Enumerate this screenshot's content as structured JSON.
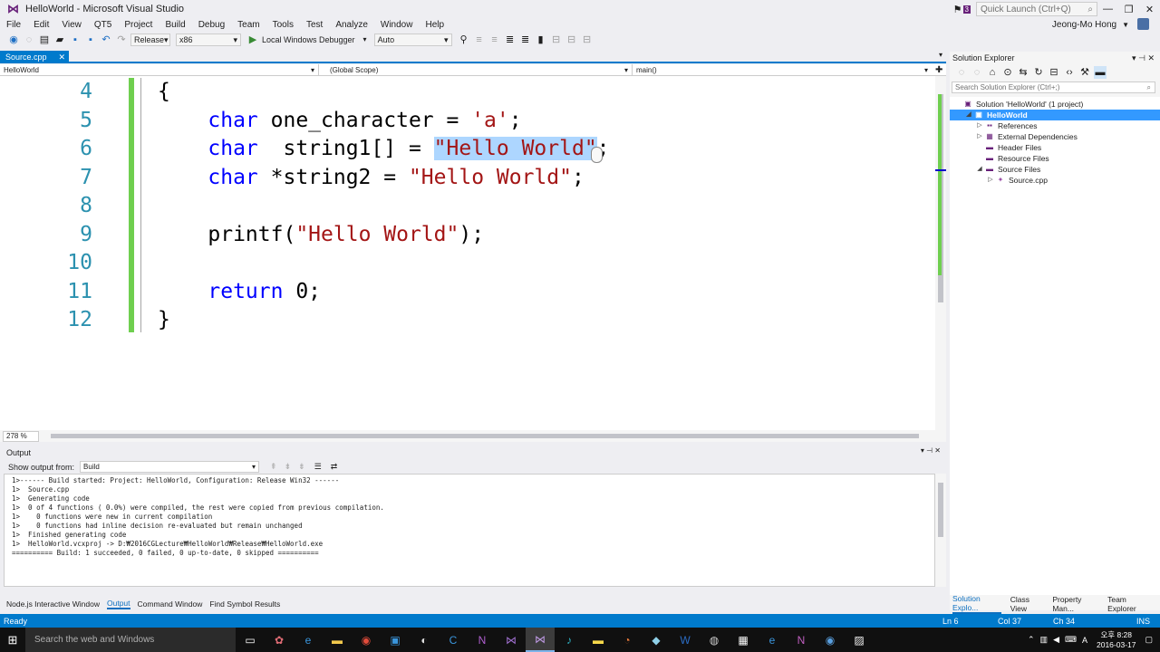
{
  "window": {
    "title": "HelloWorld - Microsoft Visual Studio",
    "logo_glyph": "⋈",
    "notification_count": "3",
    "quick_launch_placeholder": "Quick Launch (Ctrl+Q)",
    "user_name": "Jeong-Mo Hong",
    "controls": [
      "—",
      "❐",
      "✕"
    ]
  },
  "menu": [
    "File",
    "Edit",
    "View",
    "QT5",
    "Project",
    "Build",
    "Debug",
    "Team",
    "Tools",
    "Test",
    "Analyze",
    "Window",
    "Help"
  ],
  "toolbar": {
    "config": "Release",
    "platform": "x86",
    "debugger": "Local Windows Debugger",
    "debugger_mode": "Auto"
  },
  "doc_tab": {
    "label": "Source.cpp"
  },
  "navbar": {
    "project": "HelloWorld",
    "scope": "(Global Scope)",
    "member": "main()"
  },
  "editor": {
    "zoom": "278 %",
    "lines": [
      {
        "num": "4",
        "tokens": [
          {
            "t": "{",
            "c": ""
          }
        ]
      },
      {
        "num": "5",
        "tokens": [
          {
            "t": "    ",
            "c": ""
          },
          {
            "t": "char",
            "c": "kw"
          },
          {
            "t": " one_character = ",
            "c": ""
          },
          {
            "t": "'a'",
            "c": "str"
          },
          {
            "t": ";",
            "c": ""
          }
        ]
      },
      {
        "num": "6",
        "tokens": [
          {
            "t": "    ",
            "c": ""
          },
          {
            "t": "char",
            "c": "kw"
          },
          {
            "t": "  string1[] = ",
            "c": ""
          },
          {
            "t": "\"Hello World\"",
            "c": "str sel"
          },
          {
            "t": ";",
            "c": ""
          }
        ]
      },
      {
        "num": "7",
        "tokens": [
          {
            "t": "    ",
            "c": ""
          },
          {
            "t": "char",
            "c": "kw"
          },
          {
            "t": " *string2 = ",
            "c": ""
          },
          {
            "t": "\"Hello World\"",
            "c": "str"
          },
          {
            "t": ";",
            "c": ""
          }
        ]
      },
      {
        "num": "8",
        "tokens": []
      },
      {
        "num": "9",
        "tokens": [
          {
            "t": "    printf(",
            "c": ""
          },
          {
            "t": "\"Hello World\"",
            "c": "str"
          },
          {
            "t": ");",
            "c": ""
          }
        ]
      },
      {
        "num": "10",
        "tokens": []
      },
      {
        "num": "11",
        "tokens": [
          {
            "t": "    ",
            "c": ""
          },
          {
            "t": "return",
            "c": "kw"
          },
          {
            "t": " 0;",
            "c": ""
          }
        ]
      },
      {
        "num": "12",
        "tokens": [
          {
            "t": "}",
            "c": ""
          }
        ]
      }
    ]
  },
  "output": {
    "title": "Output",
    "show_from_label": "Show output from:",
    "source": "Build",
    "lines": [
      "1>------ Build started: Project: HelloWorld, Configuration: Release Win32 ------",
      "1>  Source.cpp",
      "1>  Generating code",
      "1>  0 of 4 functions ( 0.0%) were compiled, the rest were copied from previous compilation.",
      "1>    0 functions were new in current compilation",
      "1>    0 functions had inline decision re-evaluated but remain unchanged",
      "1>  Finished generating code",
      "1>  HelloWorld.vcxproj -> D:₩2016CGLecture₩HelloWorld₩Release₩HelloWorld.exe",
      "========== Build: 1 succeeded, 0 failed, 0 up-to-date, 0 skipped =========="
    ]
  },
  "bottom_tabs": [
    {
      "label": "Node.js Interactive Window",
      "active": false
    },
    {
      "label": "Output",
      "active": true
    },
    {
      "label": "Command Window",
      "active": false
    },
    {
      "label": "Find Symbol Results",
      "active": false
    }
  ],
  "solution_explorer": {
    "title": "Solution Explorer",
    "search_placeholder": "Search Solution Explorer (Ctrl+;)",
    "tree": [
      {
        "label": "Solution 'HelloWorld' (1 project)",
        "indent": 0,
        "toggle": "",
        "icon": "▣",
        "selected": false
      },
      {
        "label": "HelloWorld",
        "indent": 1,
        "toggle": "◢",
        "icon": "▣",
        "selected": true
      },
      {
        "label": "References",
        "indent": 2,
        "toggle": "▷",
        "icon": "▪▪",
        "selected": false
      },
      {
        "label": "External Dependencies",
        "indent": 2,
        "toggle": "▷",
        "icon": "▦",
        "selected": false
      },
      {
        "label": "Header Files",
        "indent": 2,
        "toggle": "",
        "icon": "▬",
        "selected": false
      },
      {
        "label": "Resource Files",
        "indent": 2,
        "toggle": "",
        "icon": "▬",
        "selected": false
      },
      {
        "label": "Source Files",
        "indent": 2,
        "toggle": "◢",
        "icon": "▬",
        "selected": false
      },
      {
        "label": "Source.cpp",
        "indent": 3,
        "toggle": "▷",
        "icon": "✦",
        "selected": false
      }
    ],
    "bottom_tabs": [
      {
        "label": "Solution Explo...",
        "active": true
      },
      {
        "label": "Class View",
        "active": false
      },
      {
        "label": "Property Man...",
        "active": false
      },
      {
        "label": "Team Explorer",
        "active": false
      }
    ]
  },
  "status": {
    "ready": "Ready",
    "ln": "Ln 6",
    "col": "Col 37",
    "ch": "Ch 34",
    "ins": "INS"
  },
  "taskbar": {
    "search_placeholder": "Search the web and Windows",
    "clock_time": "오후 8:28",
    "clock_date": "2016-03-17",
    "ime": "A"
  },
  "colors": {
    "accent": "#007acc",
    "keyword": "#0000ff",
    "string": "#a31515",
    "line_number": "#2b91af",
    "selection": "#add6ff"
  }
}
